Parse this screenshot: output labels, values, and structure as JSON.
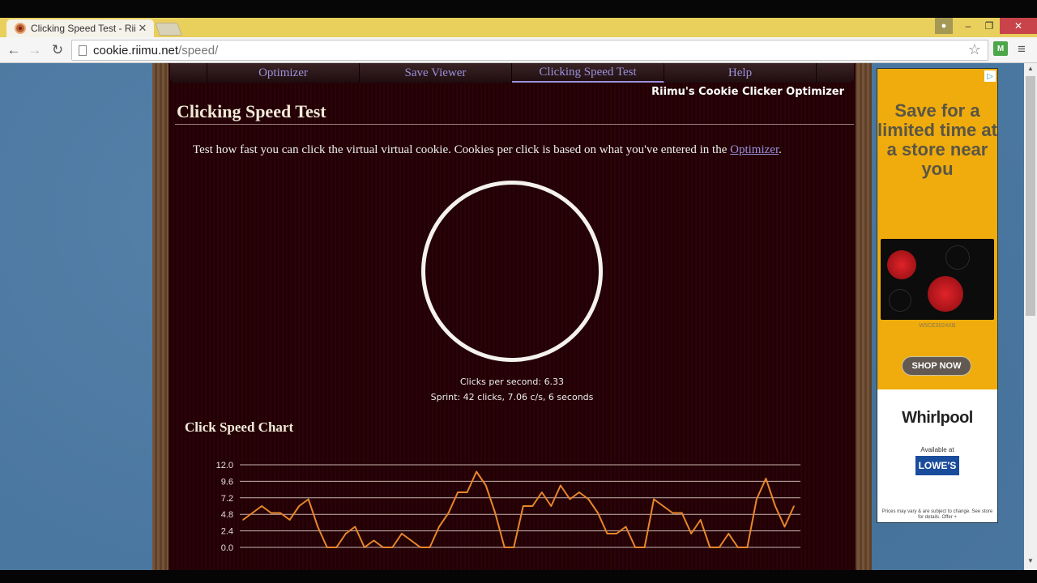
{
  "browser": {
    "tab_title": "Clicking Speed Test - Riimu",
    "tab_close": "✕",
    "url_domain": "cookie.riimu.net",
    "url_path": "/speed/",
    "back_icon": "←",
    "forward_icon": "→",
    "reload_icon": "↻",
    "star_icon": "☆",
    "menu_icon": "≡",
    "extension_label": "M",
    "user_icon": "●",
    "minimize": "–",
    "restore": "❐",
    "close": "✕"
  },
  "nav": {
    "items": [
      {
        "label": "",
        "active": false
      },
      {
        "label": "Optimizer",
        "active": false
      },
      {
        "label": "Save Viewer",
        "active": false
      },
      {
        "label": "Clicking Speed Test",
        "active": true
      },
      {
        "label": "Help",
        "active": false
      },
      {
        "label": "",
        "active": false
      }
    ]
  },
  "site_brand": "Riimu's Cookie Clicker Optimizer",
  "page": {
    "title": "Clicking Speed Test",
    "intro_text": "Test how fast you can click the virtual virtual cookie. Cookies per click is based on what you've entered in the ",
    "intro_link": "Optimizer",
    "intro_end": ".",
    "clicks_per_second": "Clicks per second: 6.33",
    "sprint": "Sprint: 42 clicks, 7.06 c/s, 6 seconds",
    "chart_title": "Click Speed Chart"
  },
  "chart_data": {
    "type": "line",
    "title": "Click Speed Chart",
    "xlabel": "",
    "ylabel": "",
    "ylim": [
      0,
      12
    ],
    "yticks": [
      "12.0",
      "9.6",
      "7.2",
      "4.8",
      "2.4",
      "0.0"
    ],
    "grid": true,
    "line_color": "#e8862a",
    "series": [
      {
        "name": "clicks",
        "values": [
          4,
          5,
          6,
          5,
          5,
          4,
          6,
          7,
          3,
          0,
          0,
          2,
          3,
          0,
          1,
          0,
          0,
          2,
          1,
          0,
          0,
          3,
          5,
          8,
          8,
          11,
          9,
          5,
          0,
          0,
          6,
          6,
          8,
          6,
          9,
          7,
          8,
          7,
          5,
          2,
          2,
          3,
          0,
          0,
          7,
          6,
          5,
          5,
          2,
          4,
          0,
          0,
          2,
          0,
          0,
          7,
          10,
          6,
          3,
          6
        ]
      }
    ]
  },
  "ad": {
    "headline": "Save for a limited time at a store near you",
    "adchoices_icon": "▷",
    "model": "W5CE3024XB",
    "button": "SHOP NOW",
    "brand": "Whirlpool",
    "available_at": "Available at",
    "retailer": "LOWE'S",
    "fine_print": "Prices may vary & are subject to change. See store for details. Offer +"
  }
}
